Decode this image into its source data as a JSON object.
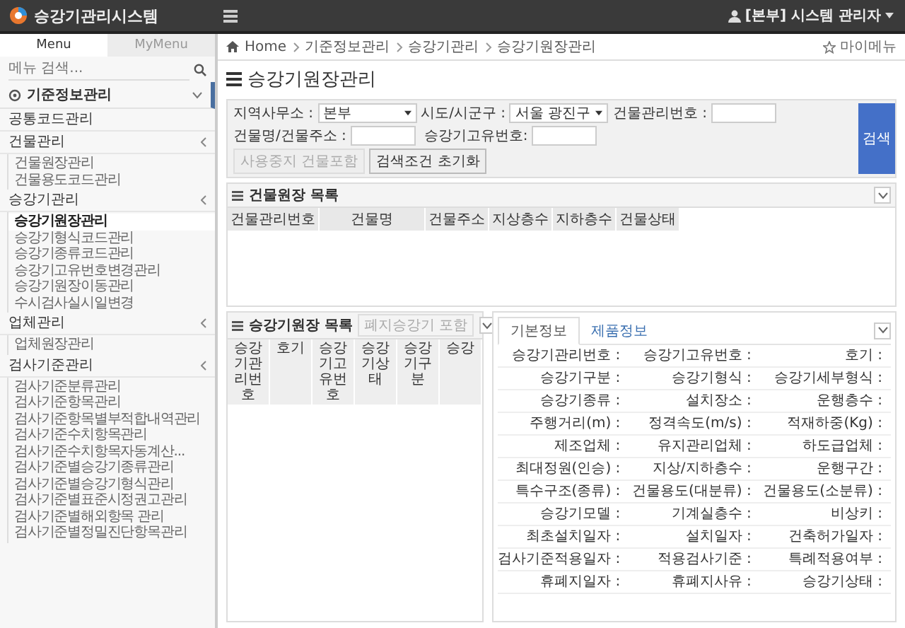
{
  "app": {
    "title": "승강기관리시스템",
    "user": "[본부] 시스템 관리자"
  },
  "sidebar": {
    "tabs": [
      {
        "label": "Menu",
        "selected": true
      },
      {
        "label": "MyMenu",
        "selected": false
      }
    ],
    "search": {
      "placeholder": "메뉴 검색..."
    },
    "section": {
      "label": "기준정보관리"
    },
    "groups": [
      {
        "label": "공통코드관리"
      },
      {
        "label": "건물관리",
        "children": [
          {
            "label": "건물원장관리",
            "selected": false
          },
          {
            "label": "건물용도코드관리",
            "selected": false
          }
        ]
      },
      {
        "label": "승강기관리",
        "children": [
          {
            "label": "승강기원장관리",
            "selected": true
          },
          {
            "label": "승강기형식코드관리",
            "selected": false
          },
          {
            "label": "승강기종류코드관리",
            "selected": false
          },
          {
            "label": "승강기고유번호변경관리",
            "selected": false
          },
          {
            "label": "승강기원장이동관리",
            "selected": false
          },
          {
            "label": "수시검사실시일변경",
            "selected": false
          }
        ]
      },
      {
        "label": "업체관리",
        "children": [
          {
            "label": "업체원장관리",
            "selected": false
          }
        ]
      },
      {
        "label": "검사기준관리",
        "children": [
          {
            "label": "검사기준분류관리",
            "selected": false
          },
          {
            "label": "검사기준항목관리",
            "selected": false
          },
          {
            "label": "검사기준항목별부적합내역관리",
            "selected": false
          },
          {
            "label": "검사기준수치항목관리",
            "selected": false
          },
          {
            "label": "검사기준수치항목자동계산...",
            "selected": false
          },
          {
            "label": "검사기준별승강기종류관리",
            "selected": false
          },
          {
            "label": "검사기준별승강기형식관리",
            "selected": false
          },
          {
            "label": "검사기준별표준시정권고관리",
            "selected": false
          },
          {
            "label": "검사기준별해외항목 관리",
            "selected": false
          },
          {
            "label": "검사기준별정밀진단항목관리",
            "selected": false
          }
        ]
      }
    ]
  },
  "breadcrumb": {
    "items": [
      "Home",
      "기준정보관리",
      "승강기관리",
      "승강기원장관리"
    ],
    "my_menu": "마이메뉴"
  },
  "page_title": "승강기원장관리",
  "filters": {
    "fields": [
      {
        "kind": "select",
        "label": "지역사무소 :",
        "value": "본부"
      },
      {
        "kind": "select",
        "label": "시도/시군구 :",
        "value": "서울 광진구"
      },
      {
        "kind": "text",
        "label": "건물관리번호 :"
      },
      {
        "kind": "text",
        "label": "건물명/건물주소 :"
      },
      {
        "kind": "text",
        "label": "승강기고유번호:"
      }
    ],
    "buttons": [
      {
        "label": "사용중지 건물포함",
        "disabled": true
      },
      {
        "label": "검색조건 초기화",
        "disabled": false
      }
    ],
    "search_button": "검색"
  },
  "building_list": {
    "title": "건물원장 목록",
    "columns": [
      "건물관리번호",
      "건물명",
      "건물주소",
      "지상층수",
      "지하층수",
      "건물상태"
    ]
  },
  "elevator_list": {
    "title": "승강기원장 목록",
    "toggle_button": "폐지승강기 포함",
    "columns": [
      "승강기관리번호",
      "호기",
      "승강기고유번호",
      "승강기상태",
      "승강기구분",
      "승강"
    ]
  },
  "details": {
    "tabs": [
      {
        "label": "기본정보",
        "selected": true
      },
      {
        "label": "제품정보",
        "selected": false
      }
    ],
    "labels": [
      "승강기관리번호 :",
      "승강기고유번호 :",
      "호기 :",
      "승강기구분 :",
      "승강기형식 :",
      "승강기세부형식 :",
      "승강기종류 :",
      "설치장소 :",
      "운행층수 :",
      "주행거리(m) :",
      "정격속도(m/s) :",
      "적재하중(Kg) :",
      "제조업체 :",
      "유지관리업체 :",
      "하도급업체 :",
      "최대정원(인승) :",
      "지상/지하층수 :",
      "운행구간 :",
      "특수구조(종류) :",
      "건물용도(대분류) :",
      "건물용도(소분류) :",
      "승강기모델 :",
      "기계실층수 :",
      "비상키 :",
      "최초설치일자 :",
      "설치일자 :",
      "건축허가일자 :",
      "검사기준적용일자 :",
      "적용검사기준 :",
      "특례적용여부 :",
      "휴폐지일자 :",
      "휴폐지사유 :",
      "승강기상태 :"
    ]
  }
}
